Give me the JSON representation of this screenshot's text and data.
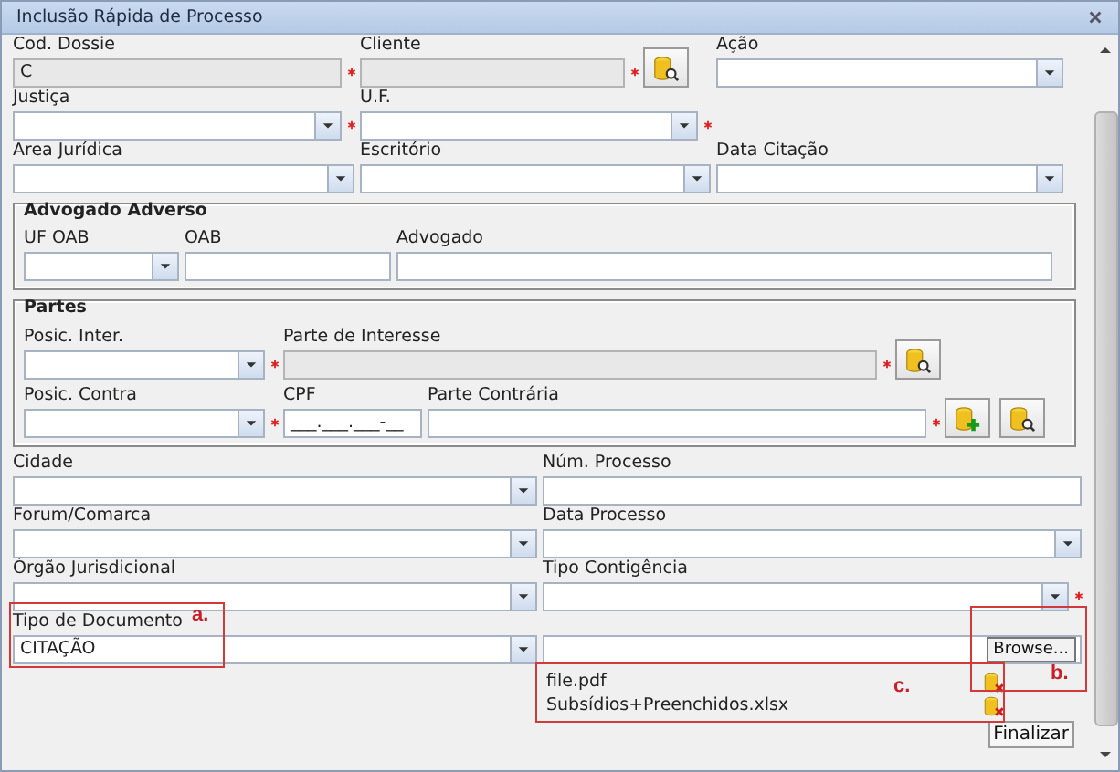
{
  "window": {
    "title": "Inclusão Rápida de Processo"
  },
  "top_rows": [
    [
      {
        "kind": "text",
        "label": "Cod. Dossie",
        "value": "C",
        "required": true,
        "disabled": true
      },
      {
        "kind": "text",
        "label": "Cliente",
        "required": true,
        "disabled": true
      },
      {
        "kind": "lookup"
      },
      {
        "kind": "select",
        "label": "Ação",
        "required": false,
        "disabled": false
      }
    ],
    [
      {
        "kind": "select",
        "label": "Justiça",
        "required": true,
        "disabled": false
      },
      {
        "kind": "select",
        "label": "U.F.",
        "required": true,
        "disabled": false
      }
    ],
    [
      {
        "kind": "select",
        "label": "Área Jurídica",
        "required": false,
        "disabled": false
      },
      {
        "kind": "select",
        "label": "Escritório",
        "required": false,
        "disabled": false
      },
      {
        "kind": "select",
        "label": "Data Citação",
        "required": false,
        "disabled": false
      }
    ]
  ],
  "groups": [
    {
      "title": "Advogado Adverso",
      "rows": [
        [
          {
            "kind": "select",
            "label": "UF OAB",
            "required": false,
            "disabled": false
          },
          {
            "kind": "text",
            "label": "OAB",
            "required": false,
            "disabled": false
          },
          {
            "kind": "text",
            "label": "Advogado",
            "required": false,
            "disabled": false
          }
        ]
      ]
    },
    {
      "title": "Partes",
      "rows": [
        [
          {
            "kind": "select",
            "label": "Posic. Inter.",
            "required": true,
            "disabled": false
          },
          {
            "kind": "text",
            "label": "Parte de Interesse",
            "required": true,
            "disabled": true
          },
          {
            "kind": "lookup"
          }
        ],
        [
          {
            "kind": "select",
            "label": "Posic. Contra",
            "required": true,
            "disabled": false
          },
          {
            "kind": "text",
            "label": "CPF",
            "value": "___.___.___-__",
            "required": false,
            "disabled": false
          },
          {
            "kind": "text",
            "label": "Parte Contrária",
            "required": true,
            "disabled": false
          },
          {
            "kind": "add"
          },
          {
            "kind": "lookup"
          }
        ]
      ]
    }
  ],
  "bottom_rows": [
    [
      {
        "kind": "select",
        "label": "Cidade",
        "required": false,
        "disabled": false
      },
      {
        "kind": "text",
        "label": "Núm. Processo",
        "required": false,
        "disabled": false
      }
    ],
    [
      {
        "kind": "select",
        "label": "Forum/Comarca",
        "required": false,
        "disabled": false
      },
      {
        "kind": "select",
        "label": "Data Processo",
        "required": false,
        "disabled": false
      }
    ],
    [
      {
        "kind": "select",
        "label": "Órgão Jurisdicional",
        "required": false,
        "disabled": false
      },
      {
        "kind": "select",
        "label": "Tipo Contigência",
        "required": true,
        "disabled": false
      }
    ],
    [
      {
        "kind": "select",
        "label": "Tipo de Documento",
        "value": "CITAÇÃO",
        "required": false,
        "disabled": false
      },
      {
        "kind": "file",
        "button": "Browse..."
      }
    ]
  ],
  "attachments": [
    {
      "name": "file.pdf"
    },
    {
      "name": "Subsídios+Preenchidos.xlsx"
    }
  ],
  "finish_button": "Finalizar",
  "annotations": [
    {
      "label": "a."
    },
    {
      "label": "b."
    },
    {
      "label": "c."
    }
  ]
}
